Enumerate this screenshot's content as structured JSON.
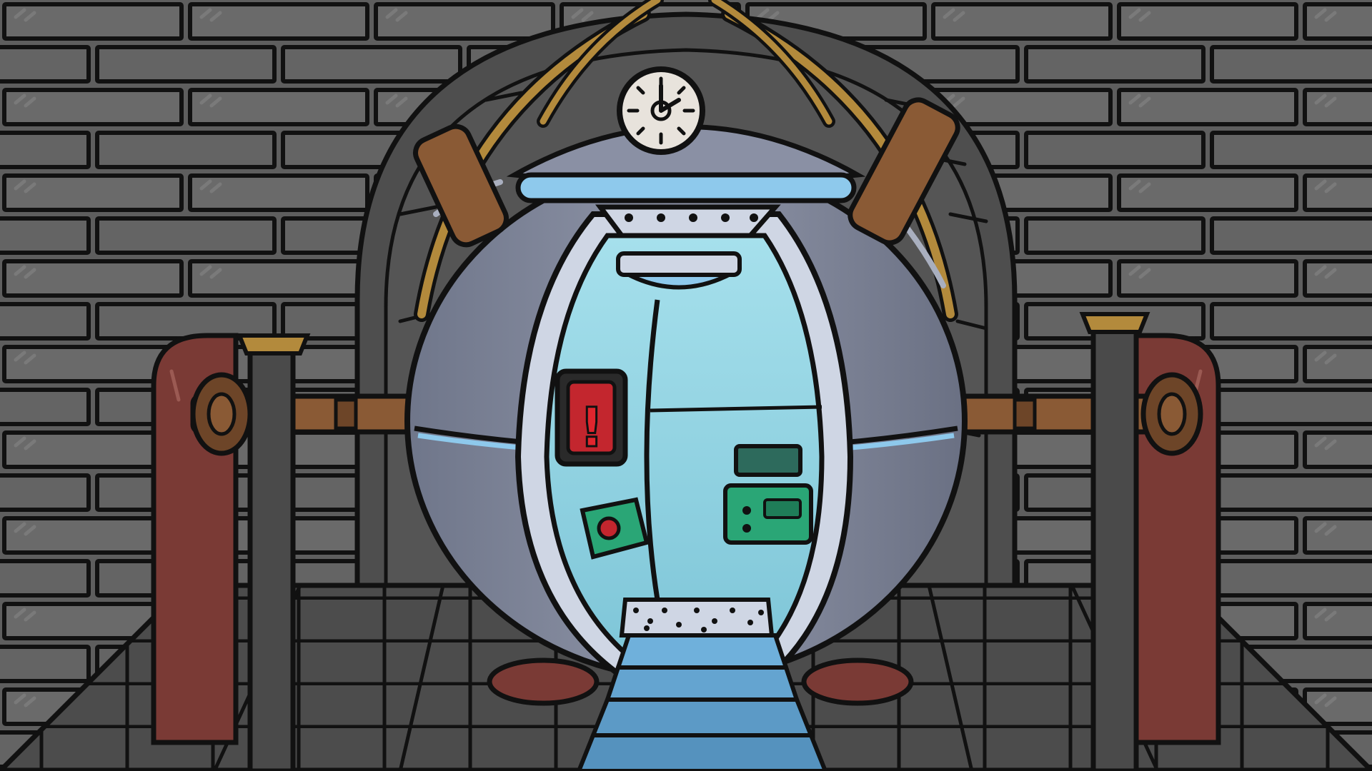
{
  "scene": {
    "subject": "time-machine-pod",
    "screen_glyph": "!",
    "icons": [
      "clock-icon",
      "alert-screen-icon",
      "red-button-icon"
    ],
    "colors": {
      "wall": "#5a5a5a",
      "mortar": "#111111",
      "pod_body": "#7d8499",
      "pod_shadow": "#5f6577",
      "interior": "#8fd3e0",
      "trim_blue": "#8ec9ec",
      "brass": "#b38a3c",
      "leather": "#8a5a35",
      "door_red": "#7a3a35",
      "console_green": "#2aa676",
      "alert_red": "#e0262e",
      "stairs": "#6fb0db"
    }
  }
}
